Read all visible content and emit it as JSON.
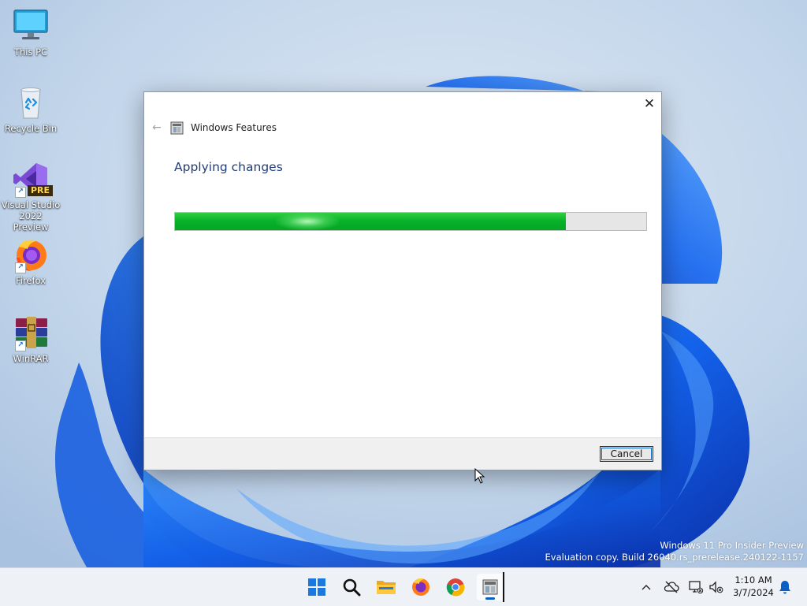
{
  "desktop": {
    "icons": [
      {
        "label": "This PC",
        "icon": "monitor-icon"
      },
      {
        "label": "Recycle Bin",
        "icon": "recycle-bin-icon"
      },
      {
        "label": "Visual Studio 2022 Preview",
        "icon": "visual-studio-icon",
        "badge": "PRE"
      },
      {
        "label": "Firefox",
        "icon": "firefox-icon"
      },
      {
        "label": "WinRAR",
        "icon": "winrar-icon"
      }
    ],
    "watermark": {
      "line1": "Windows 11 Pro Insider Preview",
      "line2": "Evaluation copy. Build 26040.rs_prerelease.240122-1157"
    }
  },
  "dialog": {
    "title": "Windows Features",
    "heading": "Applying changes",
    "progress_percent": 83,
    "cancel_label": "Cancel",
    "close_glyph": "✕",
    "back_glyph": "←"
  },
  "taskbar": {
    "apps": [
      {
        "name": "start-button",
        "icon": "windows-logo-icon"
      },
      {
        "name": "search-button",
        "icon": "search-icon"
      },
      {
        "name": "file-explorer",
        "icon": "folder-icon"
      },
      {
        "name": "firefox",
        "icon": "firefox-icon"
      },
      {
        "name": "chrome",
        "icon": "chrome-icon"
      },
      {
        "name": "windows-features",
        "icon": "windows-features-icon",
        "active": true
      }
    ],
    "tray": {
      "chevron": "^",
      "time": "1:10 AM",
      "date": "3/7/2024"
    }
  },
  "colors": {
    "accent": "#0a5fc4",
    "progress": "#07b02a",
    "heading": "#1f3d7a"
  }
}
